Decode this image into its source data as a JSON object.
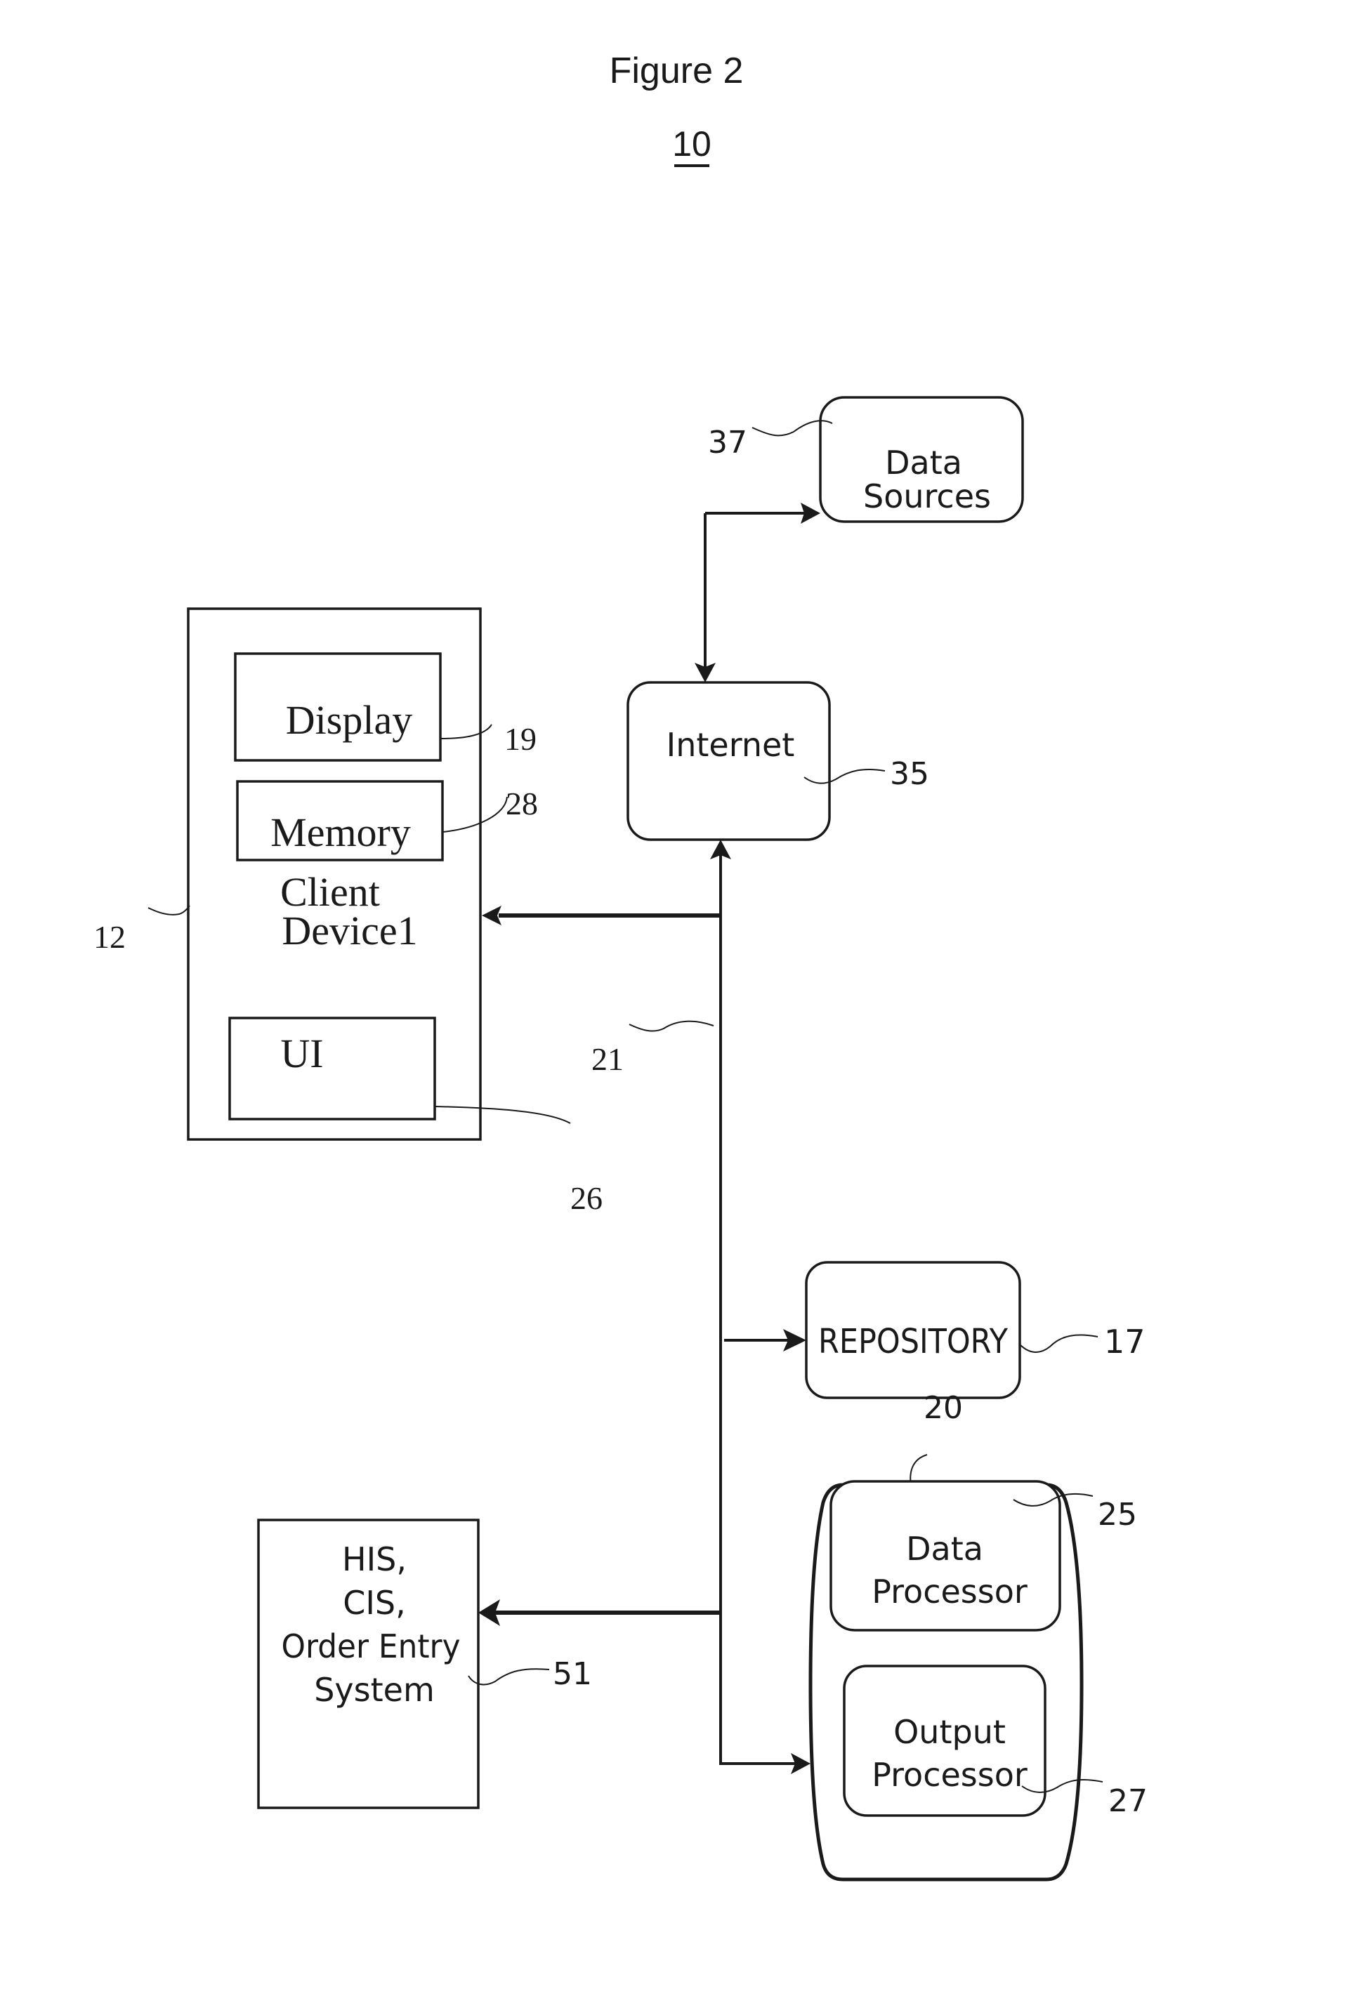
{
  "figure": {
    "title": "Figure 2",
    "system_ref": "10"
  },
  "nodes": {
    "data_sources": {
      "lines": [
        "Data",
        "Sources"
      ],
      "ref": "37"
    },
    "internet": {
      "label": "Internet",
      "ref": "35"
    },
    "client_device": {
      "lines": [
        "Client",
        "Device1"
      ],
      "ref": "12",
      "display": {
        "label": "Display",
        "ref": "19"
      },
      "memory": {
        "label": "Memory",
        "ref": "28"
      },
      "ui": {
        "label": "UI",
        "ref": "26"
      }
    },
    "network": {
      "ref": "21"
    },
    "repository": {
      "label": "REPOSITORY",
      "ref": "17"
    },
    "server": {
      "ref": "20",
      "data_processor": {
        "lines": [
          "Data",
          "Processor"
        ],
        "ref": "25"
      },
      "output_processor": {
        "lines": [
          "Output",
          "Processor"
        ],
        "ref": "27"
      }
    },
    "his": {
      "lines": [
        "HIS,",
        "CIS,",
        "Order Entry",
        "System"
      ],
      "ref": "51"
    }
  },
  "connections": [
    {
      "from": "internet",
      "to": "data_sources",
      "direction": "bidirectional"
    },
    {
      "from": "network",
      "to": "internet",
      "direction": "to"
    },
    {
      "from": "network",
      "to": "client_device",
      "direction": "to"
    },
    {
      "from": "network",
      "to": "repository",
      "direction": "to"
    },
    {
      "from": "network",
      "to": "his",
      "direction": "to"
    },
    {
      "from": "network",
      "to": "server",
      "direction": "to"
    }
  ]
}
